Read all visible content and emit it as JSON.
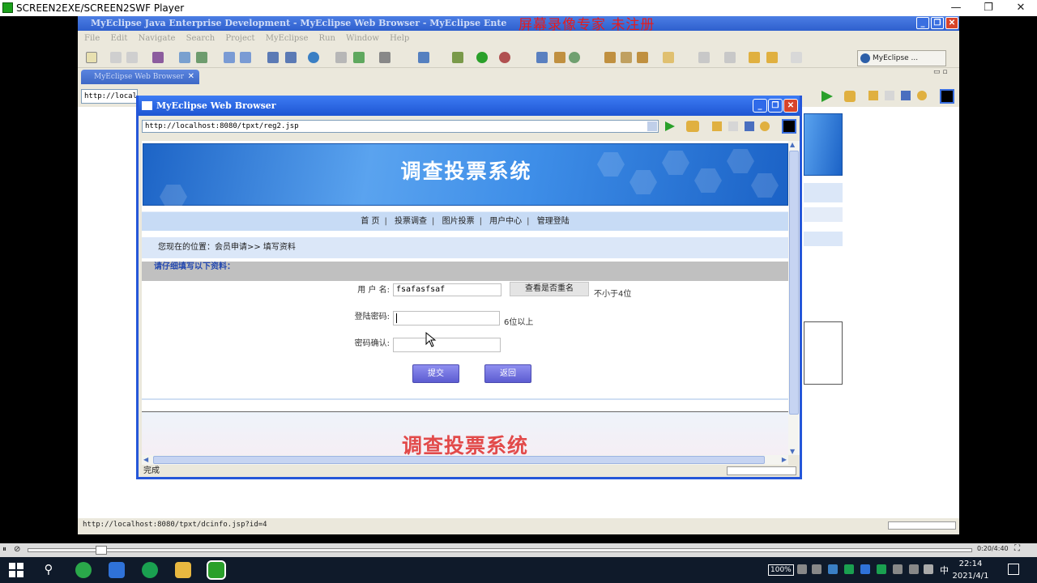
{
  "player": {
    "title": "SCREEN2EXE/SCREEN2SWF Player"
  },
  "ide": {
    "title": "MyEclipse Java Enterprise Development - MyEclipse Web Browser - MyEclipse Ente",
    "watermark": "屏幕录像专家  未注册",
    "menu": [
      "File",
      "Edit",
      "Navigate",
      "Search",
      "Project",
      "MyEclipse",
      "Run",
      "Window",
      "Help"
    ],
    "perspective": "MyEclipse ...",
    "tab_label": "MyEclipse Web Browser",
    "url_partial": "http://localh",
    "status_url": "http://localhost:8080/tpxt/dcinfo.jsp?id=4"
  },
  "browser": {
    "title": "MyEclipse Web Browser",
    "url": "http://localhost:8080/tpxt/reg2.jsp",
    "status": "完成"
  },
  "site": {
    "banner_title": "调查投票系统",
    "nav": [
      "首 页",
      "投票调查",
      "图片投票",
      "用户中心",
      "管理登陆"
    ],
    "breadcrumb": "您现在的位置：会员申请>> 填写资料",
    "fill_header": "请仔细填写以下资料：",
    "footer_title": "调查投票系统"
  },
  "form": {
    "username_label": "用 户 名:",
    "username_value": "fsafasfsaf",
    "check_button": "查看是否重名",
    "username_hint": "不小于4位",
    "password_label": "登陆密码:",
    "password_hint": "6位以上",
    "confirm_label": "密码确认:",
    "submit": "提交",
    "back": "返回"
  },
  "playback": {
    "time": "0:20/4:40"
  },
  "taskbar": {
    "clock_time": "22:14",
    "clock_date": "2021/4/1",
    "battery": "100%",
    "ime": "中"
  },
  "colors": {
    "accent": "#2557d9",
    "watermark": "#e61c1c",
    "banner": "#3e8ee8"
  }
}
